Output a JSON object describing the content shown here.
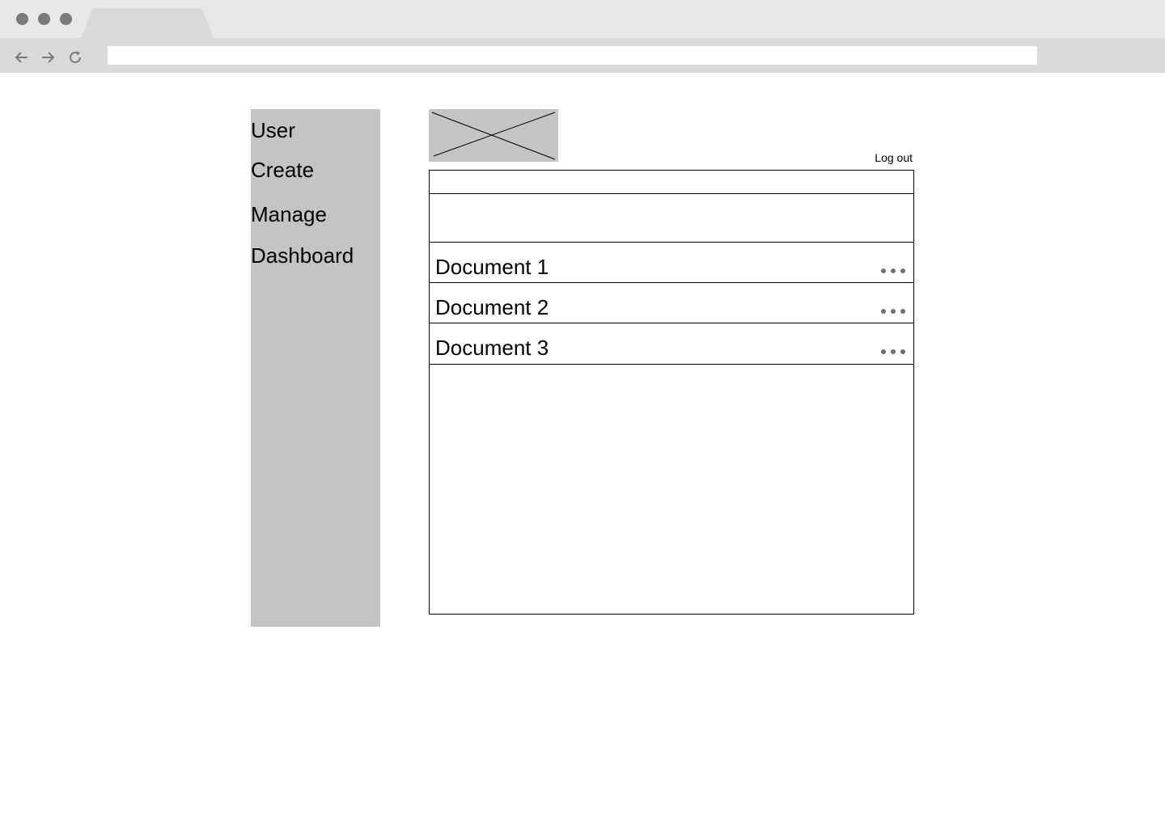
{
  "browser": {
    "address_value": "",
    "icons": [
      "back-arrow-icon",
      "forward-arrow-icon",
      "reload-icon"
    ]
  },
  "sidebar": {
    "items": [
      {
        "label": "User"
      },
      {
        "label": "Create"
      },
      {
        "label": "Manage"
      },
      {
        "label": "Dashboard"
      }
    ]
  },
  "header": {
    "logout_label": "Log out",
    "logo_icon": "image-placeholder-icon"
  },
  "documents": [
    {
      "label": "Document 1",
      "menu_icon": "more-options-icon"
    },
    {
      "label": "Document 2",
      "menu_icon": "more-options-icon"
    },
    {
      "label": "Document 3",
      "menu_icon": "more-options-icon"
    }
  ],
  "colors": {
    "chrome_tabbar": "#e8e8e8",
    "chrome_toolbar": "#dadada",
    "placeholder_gray": "#c4c4c4",
    "dots_gray": "#7a7a7a"
  }
}
